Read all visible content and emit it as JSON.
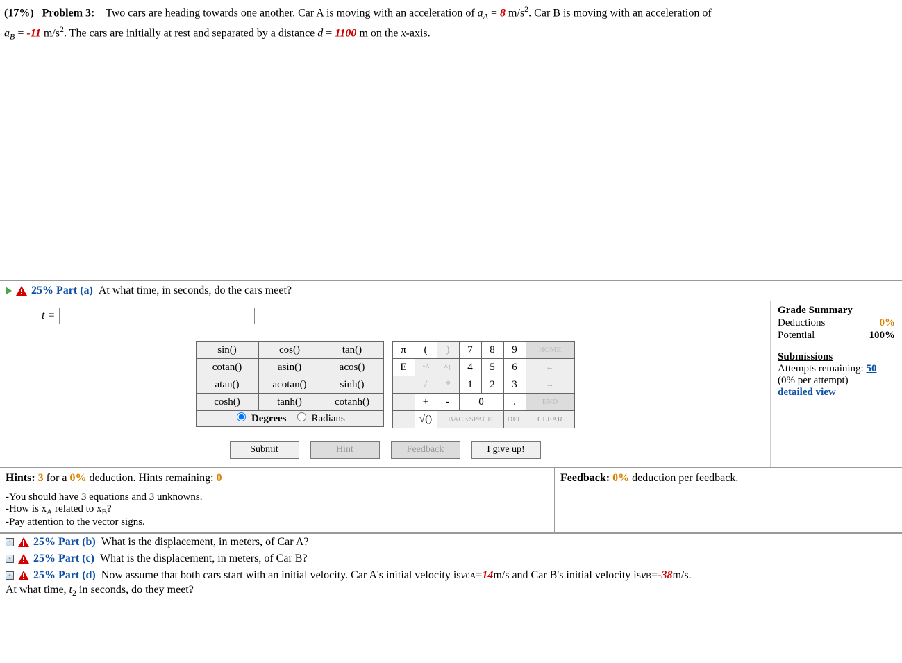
{
  "problem": {
    "percent": "(17%)",
    "label": "Problem 3:",
    "line1_pre": "Two cars are heading towards one another. Car A is moving with an acceleration of ",
    "aA_var": "a",
    "aA_sub": "A",
    "aA_eq": " = ",
    "aA_val": "8",
    "aA_unit": " m/s",
    "line1_post": ". Car B is moving with an acceleration of",
    "aB_var": "a",
    "aB_sub": "B",
    "aB_eq": " = ",
    "aB_val": "-11",
    "aB_unit": " m/s",
    "line2_mid": ". The cars are initially at rest and separated by a distance ",
    "d_var": "d",
    "d_eq": " = ",
    "d_val": "1100",
    "d_unit": " m on the ",
    "x_var": "x",
    "line2_end": "-axis."
  },
  "parts": {
    "a": {
      "label": "25% Part (a)",
      "text": "At what time, in seconds, do the cars meet?"
    },
    "b": {
      "label": "25% Part (b)",
      "text": "What is the displacement, in meters, of Car A?"
    },
    "c": {
      "label": "25% Part (c)",
      "text": "What is the displacement, in meters, of Car B?"
    },
    "d": {
      "label": "25% Part (d)",
      "text_pre": "Now assume that both cars start with an initial velocity. Car A's initial velocity is ",
      "v0A_var": "v",
      "v0A_sub": "0A",
      "v0A_eq": " = ",
      "v0A_val": "14",
      "v0A_unit": " m/s and Car B's initial velocity is ",
      "vB_var": "v",
      "vB_sub": "B",
      "vB_eq": " = ",
      "vB_val": "-38",
      "vB_unit": " m/s.",
      "line2_pre": "At what time, ",
      "t2_var": "t",
      "t2_sub": "2",
      "line2_post": " in seconds, do they meet?"
    }
  },
  "answer": {
    "varLabel": "t =",
    "value": ""
  },
  "grade": {
    "header": "Grade Summary",
    "deductions_label": "Deductions",
    "deductions_val": "0%",
    "potential_label": "Potential",
    "potential_val": "100%",
    "sub_header": "Submissions",
    "attempts_label": "Attempts remaining: ",
    "attempts_val": "50",
    "per_attempt": "(0% per attempt)",
    "detailed": "detailed view"
  },
  "keypad": {
    "funcs": [
      [
        "sin()",
        "cos()",
        "tan()"
      ],
      [
        "cotan()",
        "asin()",
        "acos()"
      ],
      [
        "atan()",
        "acotan()",
        "sinh()"
      ],
      [
        "cosh()",
        "tanh()",
        "cotanh()"
      ]
    ],
    "degrees": "Degrees",
    "radians": "Radians",
    "pi": "π",
    "lpar": "(",
    "rpar": ")",
    "n7": "7",
    "n8": "8",
    "n9": "9",
    "home": "HOME",
    "E": "E",
    "upc": "↑^",
    "dnc": "^↓",
    "n4": "4",
    "n5": "5",
    "n6": "6",
    "left": "←",
    "blank": "",
    "slash": "/",
    "star": "*",
    "n1": "1",
    "n2": "2",
    "n3": "3",
    "right": "→",
    "plus": "+",
    "minus": "-",
    "n0": "0",
    "dot": ".",
    "end": "END",
    "sqrt": "√()",
    "bksp": "BACKSPACE",
    "del": "DEL",
    "clear": "CLEAR"
  },
  "buttons": {
    "submit": "Submit",
    "hint": "Hint",
    "feedback": "Feedback",
    "giveup": "I give up!"
  },
  "hints": {
    "header_pre": "Hints: ",
    "count": "3",
    "for_a": " for a ",
    "ded": "0%",
    "ded_post": " deduction. Hints remaining: ",
    "remaining": "0",
    "list": [
      "-You should have 3 equations and 3 unknowns.",
      "-How is xA related to xB?",
      "-Pay attention to the vector signs."
    ],
    "xA_var": "x",
    "xA_sub": "A",
    "xB_var": "x",
    "xB_sub": "B"
  },
  "feedback": {
    "label": "Feedback: ",
    "ded": "0%",
    "post": " deduction per feedback."
  }
}
